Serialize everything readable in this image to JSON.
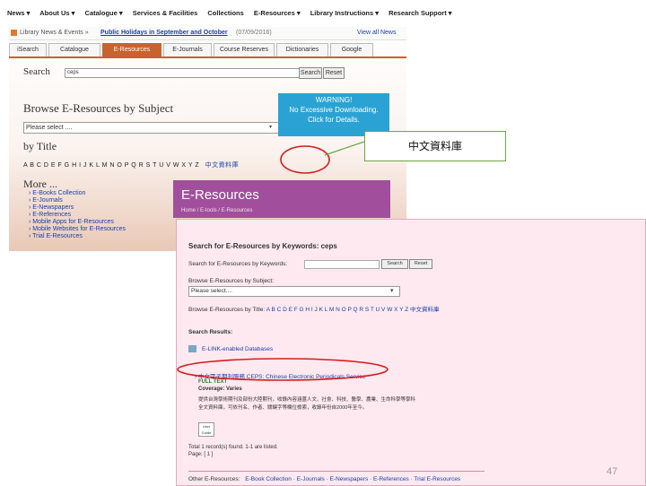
{
  "topnav": [
    "News ▾",
    "About Us ▾",
    "Catalogue ▾",
    "Services & Facilities",
    "Collections",
    "E-Resources ▾",
    "Library Instructions ▾",
    "Research Support ▾"
  ],
  "newsbar": {
    "label": "Library News & Events »",
    "headline": "Public Holidays in September and October",
    "date": "(07/09/2016)",
    "more": "View all News"
  },
  "tabs": [
    "iSearch",
    "Catalogue",
    "E-Resources",
    "E-Journals",
    "Course Reserves",
    "Dictionaries",
    "Google"
  ],
  "active_tab": "E-Resources",
  "search": {
    "label": "Search",
    "value": "ceps",
    "search_button": "Search",
    "reset_button": "Reset"
  },
  "browse": {
    "title": "Browse E-Resources by Subject",
    "select_value": "Please select ...."
  },
  "warning": {
    "line1": "WARNING!",
    "line2": "No Excessive Downloading.",
    "line3": "Click for Details."
  },
  "bytitle": {
    "label": "by Title",
    "letters": "A  B  C  D  E  F  G  H  I  J  K  L  M  N  O  P  Q  R  S  T  U  V  W  X  Y  Z",
    "chinese_link": "中文資料庫"
  },
  "more": {
    "label": "More ...",
    "items": [
      "E-Books Collection",
      "E-Journals",
      "E-Newspapers",
      "E-References",
      "Mobile Apps for E-Resources",
      "Mobile Websites for E-Resources",
      "Trial E-Resources"
    ]
  },
  "callout": "中文資料庫",
  "header2": {
    "title": "E-Resources",
    "breadcrumb": "Home  /  E-tools  /  E-Resources"
  },
  "results_page": {
    "heading": "Search for E-Resources by Keywords: ceps",
    "keywords_label": "Search for E-Resources by Keywords:",
    "search_button": "Search",
    "reset_button": "Reset",
    "browse_label": "Browse E-Resources by Subject:",
    "select_value": "Please select....",
    "bytitle_label": "Browse E-Resources by Title:",
    "letters": "A B C D E F G H I J K L M N O P Q R S T U V W X Y Z 中文資料庫",
    "results_label": "Search Results:",
    "link_label": "E-LINK-enabled Databases",
    "result_title": "中文電子期刊服務 CEPS: Chinese Electronic Periodicals Service",
    "fulltext": "FULL TEXT",
    "coverage": "Coverage: Varies",
    "desc_line1": "提供台灣學術期刊及部份大陸期刊，收錄內容涵蓋人文、社會、科技、醫學、農業、生命科學等學科",
    "desc_line2": "全文資料庫，可依刊名、作者、關鍵字等欄位檢索，收錄年份自2000年至今。",
    "user_guide": "User Guide",
    "total": "Total 1 record(s) found. 1-1 are listed.",
    "page": "Page: [ 1 ]",
    "footer_links": [
      "Other E-Resources:",
      "E-Book Collection",
      "E-Journals",
      "E-Newspapers",
      "E-References",
      "Trial E-Resources"
    ]
  },
  "page_number": "47",
  "colors": {
    "tab_active": "#c8632f",
    "warning_bg": "#2aa3d4",
    "header2_bg": "#a14f9c",
    "results_bg": "#fde9ef",
    "link": "#1a3faa",
    "highlight_circle": "#d81b1b",
    "callout_border": "#6ea642"
  }
}
